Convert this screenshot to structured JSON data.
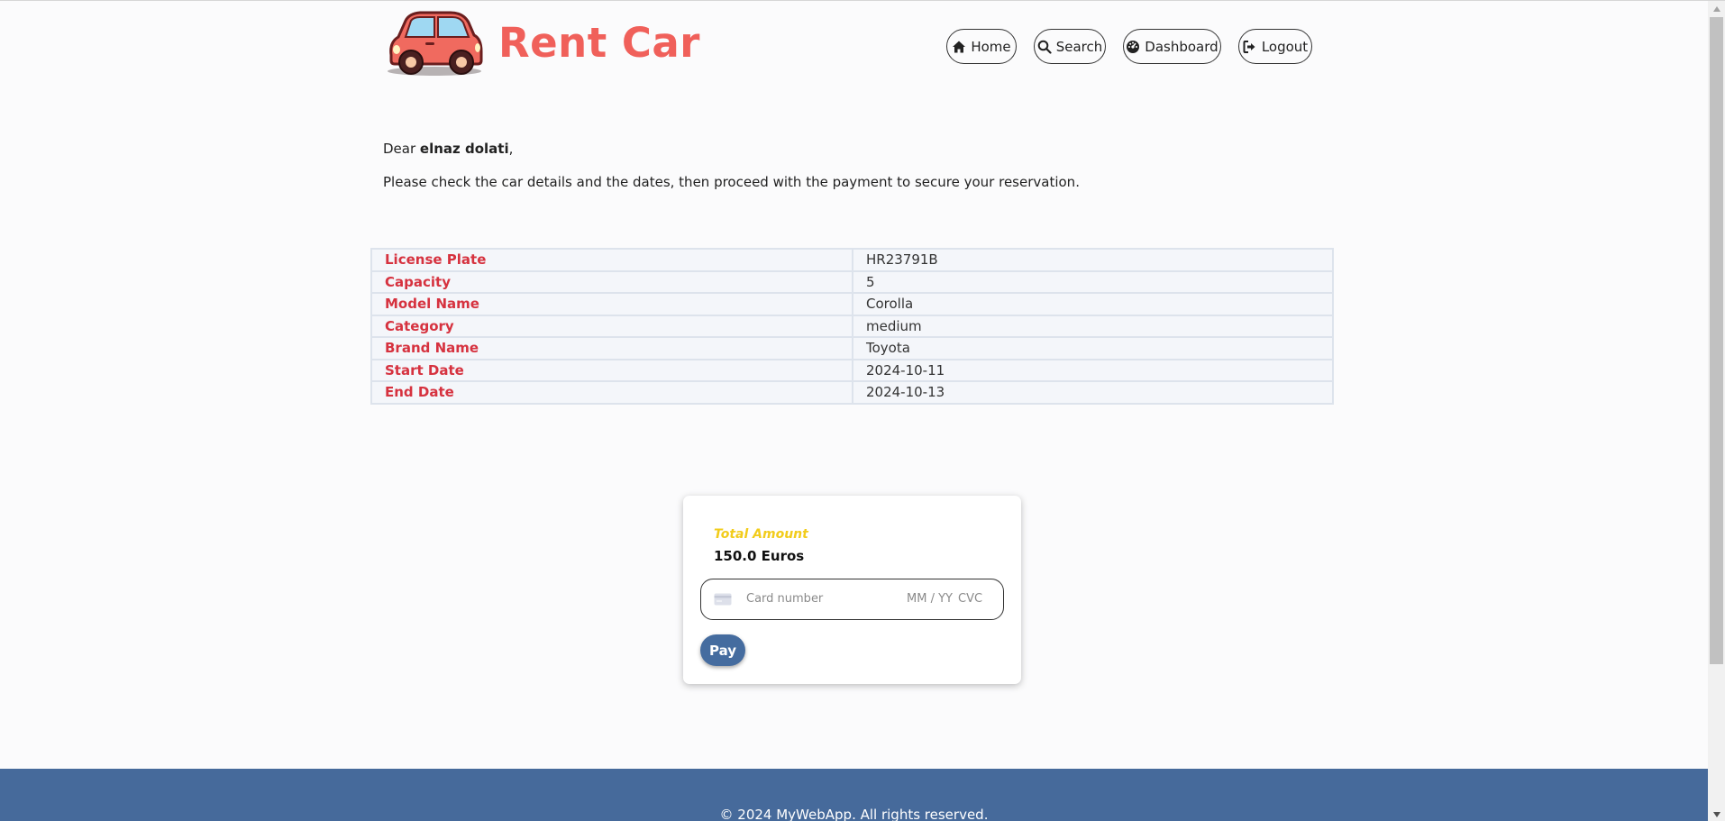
{
  "header": {
    "brand": "Rent Car",
    "logo_icon": "car-logo-icon",
    "nav": [
      {
        "label": "Home",
        "icon": "home-icon"
      },
      {
        "label": "Search",
        "icon": "search-icon"
      },
      {
        "label": "Dashboard",
        "icon": "dashboard-icon"
      },
      {
        "label": "Logout",
        "icon": "logout-icon"
      }
    ]
  },
  "intro": {
    "greeting": "Dear ",
    "user_name": "elnaz dolati",
    "greeting_end": ",",
    "message": "Please check the car details and the dates, then proceed with the payment to secure your reservation."
  },
  "details": [
    {
      "label": "License Plate",
      "value": "HR23791B"
    },
    {
      "label": "Capacity",
      "value": "5"
    },
    {
      "label": "Model Name",
      "value": "Corolla"
    },
    {
      "label": "Category",
      "value": "medium"
    },
    {
      "label": "Brand Name",
      "value": "Toyota"
    },
    {
      "label": "Start Date",
      "value": "2024-10-11"
    },
    {
      "label": "End Date",
      "value": "2024-10-13"
    }
  ],
  "payment": {
    "total_label": "Total Amount",
    "total_value": "150.0 Euros",
    "card_placeholder": "Card number",
    "expiry_placeholder": "MM / YY",
    "cvc_placeholder": "CVC",
    "pay_label": "Pay"
  },
  "footer": {
    "text": "© 2024 MyWebApp. All rights reserved."
  },
  "colors": {
    "brand": "#f0605a",
    "label_red": "#d6323f",
    "total_yellow": "#f2cc1b",
    "footer_blue": "#466a9b",
    "pay_button": "#456c9f"
  }
}
